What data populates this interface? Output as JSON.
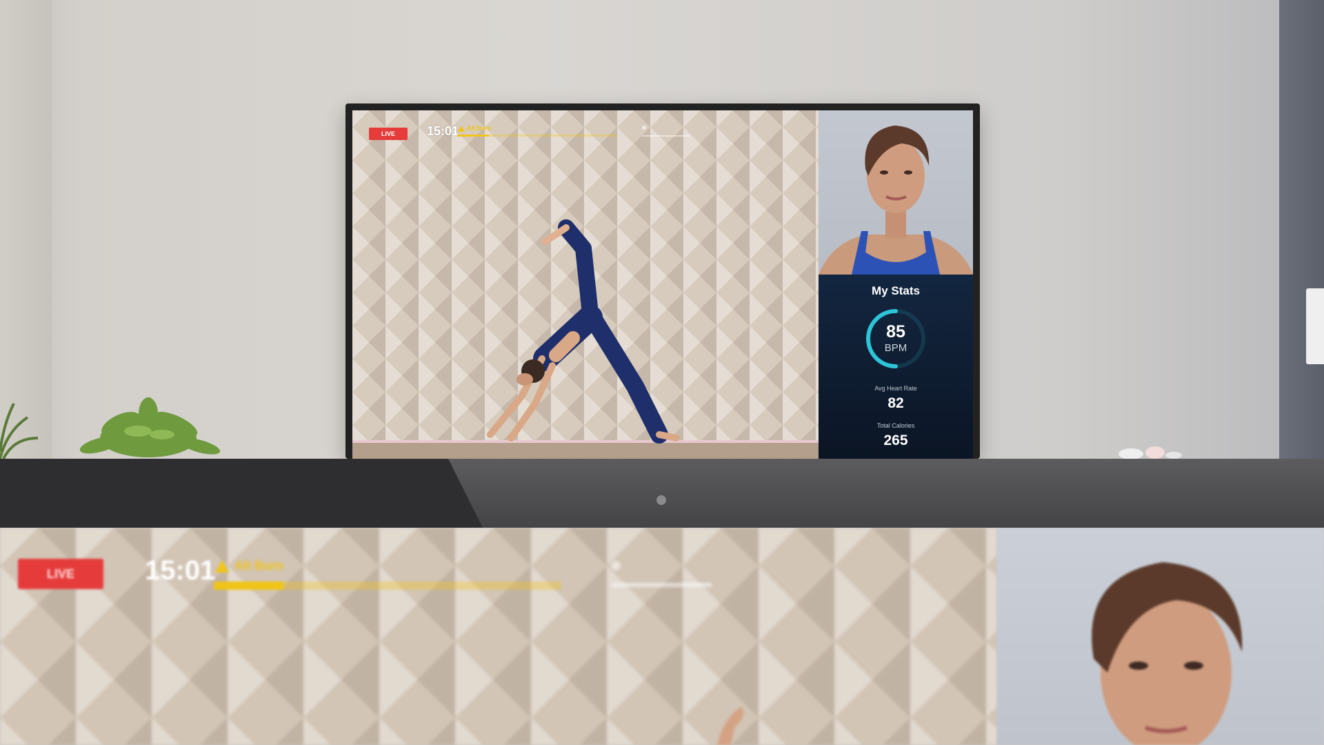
{
  "tv": {
    "live_badge": "LIVE",
    "timer": "15:01",
    "segment_label": "Alt Burn",
    "segment_progress": 0.2,
    "stats": {
      "title": "My Stats",
      "bpm_value": "85",
      "bpm_unit": "BPM",
      "avg_heart_rate_label": "Avg Heart Rate",
      "avg_heart_rate_value": "82",
      "total_calories_label": "Total Calories",
      "total_calories_value": "265"
    }
  },
  "zoom": {
    "live_badge": "LIVE",
    "timer": "15:01",
    "segment_label": "Alt Burn",
    "segment_progress": 0.2
  },
  "colors": {
    "live_red": "#e53b3b",
    "progress_yellow": "#f0c419",
    "ring_cyan": "#2ec4d8",
    "stats_navy": "#0f1d30"
  },
  "icons": {
    "segment": "flame-icon",
    "next": "dot-icon"
  }
}
